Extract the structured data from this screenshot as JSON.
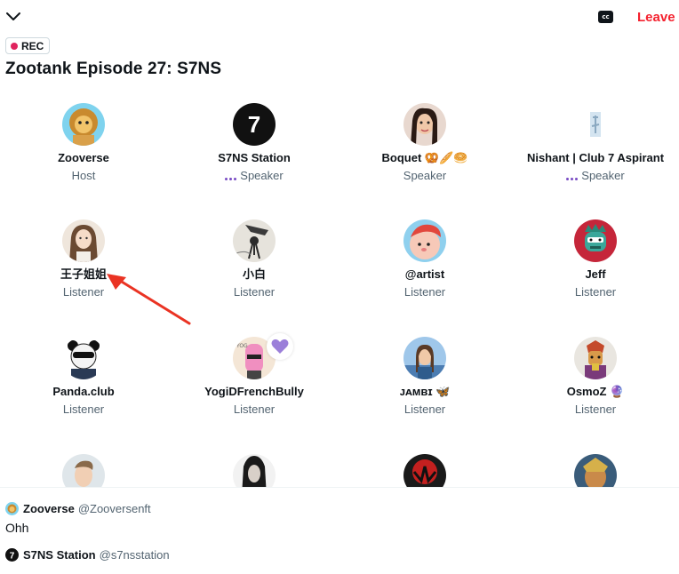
{
  "topbar": {
    "collapse_icon": "chevron-down-icon",
    "captions_label": "cc",
    "leave_label": "Leave"
  },
  "space": {
    "rec_label": "REC",
    "title": "Zootank Episode 27: S7NS"
  },
  "participants": [
    {
      "name": "Zooverse",
      "role": "Host",
      "speaker": false
    },
    {
      "name": "S7NS Station",
      "role": "Speaker",
      "speaker": true
    },
    {
      "name": "Boquet 🥨🥖🥯",
      "role": "Speaker",
      "speaker": false
    },
    {
      "name": "Nishant | Club 7 Aspirant",
      "role": "Speaker",
      "speaker": true
    },
    {
      "name": "王子姐姐",
      "role": "Listener",
      "speaker": false
    },
    {
      "name": "小白",
      "role": "Listener",
      "speaker": false
    },
    {
      "name": "@artist",
      "role": "Listener",
      "speaker": false
    },
    {
      "name": "Jeff",
      "role": "Listener",
      "speaker": false
    },
    {
      "name": "Panda.club",
      "role": "Listener",
      "speaker": false
    },
    {
      "name": "YogiDFrenchBully",
      "role": "Listener",
      "speaker": false
    },
    {
      "name": "ᴊᴀᴍʙɪ 🦋",
      "role": "Listener",
      "speaker": false
    },
    {
      "name": "OsmoZ 🔮",
      "role": "Listener",
      "speaker": false
    },
    {
      "name": "",
      "role": "",
      "speaker": false
    },
    {
      "name": "",
      "role": "",
      "speaker": false
    },
    {
      "name": "",
      "role": "",
      "speaker": false
    },
    {
      "name": "",
      "role": "",
      "speaker": false
    }
  ],
  "chat": [
    {
      "name": "Zooverse",
      "handle": "@Zooversenft",
      "text": "Ohh"
    },
    {
      "name": "S7NS Station",
      "handle": "@s7nsstation",
      "text": ""
    }
  ],
  "colors": {
    "accent_red": "#f4212e",
    "rec_dot": "#e0245e",
    "speaker_purple": "#794bc4",
    "muted_text": "#536471",
    "annotation_arrow": "#ea3323"
  }
}
